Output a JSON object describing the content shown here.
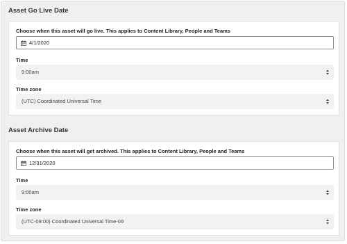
{
  "go_live": {
    "section_title": "Asset Go Live Date",
    "choose_label": "Choose when this asset will go live. This applies to Content Library, People and Teams",
    "date_value": "4/1/2020",
    "time_label": "Time",
    "time_value": "9:00am",
    "timezone_label": "Time zone",
    "timezone_value": "(UTC) Coordinated Universal Time"
  },
  "archive": {
    "section_title": "Asset Archive Date",
    "choose_label": "Choose when this asset will get archived. This applies to Content Library, People and Teams",
    "date_value": "12/31/2020",
    "time_label": "Time",
    "time_value": "9:00am",
    "timezone_label": "Time zone",
    "timezone_value": "(UTC-09:00) Coordinated Universal Time-09"
  },
  "icons": {
    "date": "calendar-icon",
    "select": "select-arrows-icon"
  }
}
